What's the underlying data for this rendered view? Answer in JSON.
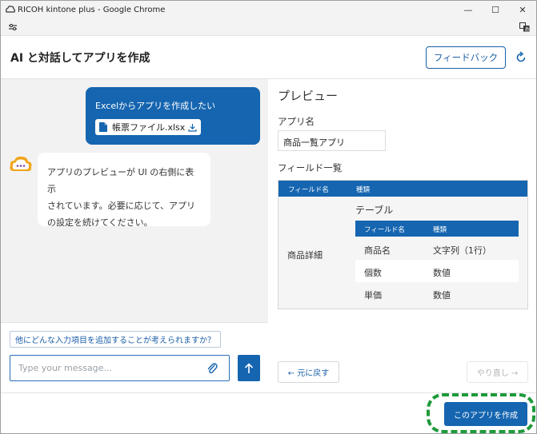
{
  "window": {
    "title": "RICOH kintone plus - Google Chrome",
    "minimize": "—",
    "maximize": "☐",
    "close": "✕"
  },
  "header": {
    "title": "AI と対話してアプリを作成",
    "feedback_label": "フィードバック"
  },
  "chat": {
    "user_message": "Excelからアプリを作成したい",
    "attachment_name": "帳票ファイル.xlsx",
    "bot_message_lines": [
      "アプリのプレビューが UI の右側に表示",
      "されています。必要に応じて、アプリ",
      "の設定を続けてください。"
    ],
    "suggestion": "他にどんな入力項目を追加することが考えられますか？",
    "input_placeholder": "Type your message..."
  },
  "preview": {
    "title": "プレビュー",
    "app_name_label": "アプリ名",
    "app_name_value": "商品一覧アプリ",
    "field_list_label": "フィールド一覧",
    "columns": [
      "フィールド名",
      "種類"
    ],
    "row_label": "商品詳細",
    "subtable": {
      "title": "テーブル",
      "columns": [
        "フィールド名",
        "種類"
      ],
      "rows": [
        {
          "name": "商品名",
          "type": "文字列（1行）"
        },
        {
          "name": "個数",
          "type": "数値"
        },
        {
          "name": "単価",
          "type": "数値"
        }
      ]
    },
    "undo_label": "← 元に戻す",
    "redo_label": "やり直し →"
  },
  "footer": {
    "create_label": "このアプリを作成"
  },
  "colors": {
    "primary": "#1565b0",
    "highlight": "#1e9a3a",
    "panel_bg": "#f2f2f2"
  }
}
